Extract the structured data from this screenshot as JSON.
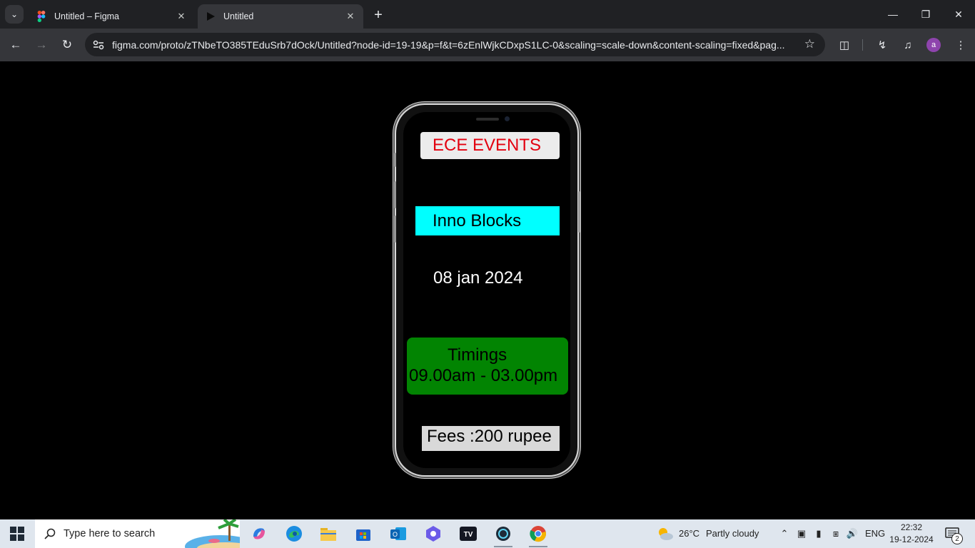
{
  "browser": {
    "tabs": [
      {
        "title": "Untitled – Figma",
        "favicon": "figma-icon"
      },
      {
        "title": "Untitled",
        "favicon": "play-icon"
      }
    ],
    "url": "figma.com/proto/zTNbeTO385TEduSrb7dOck/Untitled?node-id=19-19&p=f&t=6zEnlWjkCDxpS1LC-0&scaling=scale-down&content-scaling=fixed&pag...",
    "profile_initial": "a"
  },
  "event": {
    "header": "ECE EVENTS",
    "name": "Inno Blocks",
    "date": "08 jan 2024",
    "timings_label": "Timings",
    "timings_value": "09.00am - 03.00pm",
    "fees": "Fees :200 rupee"
  },
  "colors": {
    "header_text": "#e3000f",
    "name_bg": "#00ffff",
    "timings_bg": "#028402",
    "fees_bg": "#d9d9d9"
  },
  "taskbar": {
    "search_placeholder": "Type here to search",
    "weather_temp": "26°C",
    "weather_desc": "Partly cloudy",
    "language": "ENG",
    "time": "22:32",
    "date": "19-12-2024",
    "notification_count": "2"
  }
}
